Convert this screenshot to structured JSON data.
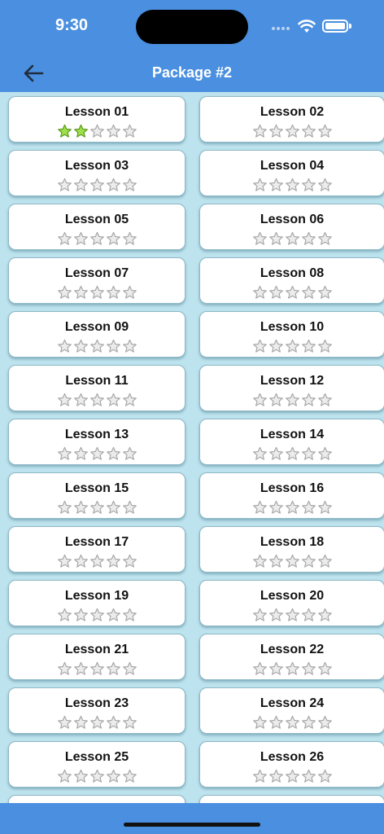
{
  "status": {
    "time": "9:30"
  },
  "nav": {
    "title": "Package #2",
    "back_icon": "arrow-left-icon"
  },
  "colors": {
    "bar": "#4a8fe0",
    "background": "#bde3ee",
    "star_filled": "#9ee04a",
    "star_empty": "#ececec"
  },
  "max_stars": 5,
  "lessons": [
    {
      "title": "Lesson 01",
      "stars": 2
    },
    {
      "title": "Lesson 02",
      "stars": 0
    },
    {
      "title": "Lesson 03",
      "stars": 0
    },
    {
      "title": "Lesson 04",
      "stars": 0
    },
    {
      "title": "Lesson 05",
      "stars": 0
    },
    {
      "title": "Lesson 06",
      "stars": 0
    },
    {
      "title": "Lesson 07",
      "stars": 0
    },
    {
      "title": "Lesson 08",
      "stars": 0
    },
    {
      "title": "Lesson 09",
      "stars": 0
    },
    {
      "title": "Lesson 10",
      "stars": 0
    },
    {
      "title": "Lesson 11",
      "stars": 0
    },
    {
      "title": "Lesson 12",
      "stars": 0
    },
    {
      "title": "Lesson 13",
      "stars": 0
    },
    {
      "title": "Lesson 14",
      "stars": 0
    },
    {
      "title": "Lesson 15",
      "stars": 0
    },
    {
      "title": "Lesson 16",
      "stars": 0
    },
    {
      "title": "Lesson 17",
      "stars": 0
    },
    {
      "title": "Lesson 18",
      "stars": 0
    },
    {
      "title": "Lesson 19",
      "stars": 0
    },
    {
      "title": "Lesson 20",
      "stars": 0
    },
    {
      "title": "Lesson 21",
      "stars": 0
    },
    {
      "title": "Lesson 22",
      "stars": 0
    },
    {
      "title": "Lesson 23",
      "stars": 0
    },
    {
      "title": "Lesson 24",
      "stars": 0
    },
    {
      "title": "Lesson 25",
      "stars": 0
    },
    {
      "title": "Lesson 26",
      "stars": 0
    },
    {
      "title": "",
      "stars": 0
    },
    {
      "title": "",
      "stars": 0
    }
  ]
}
